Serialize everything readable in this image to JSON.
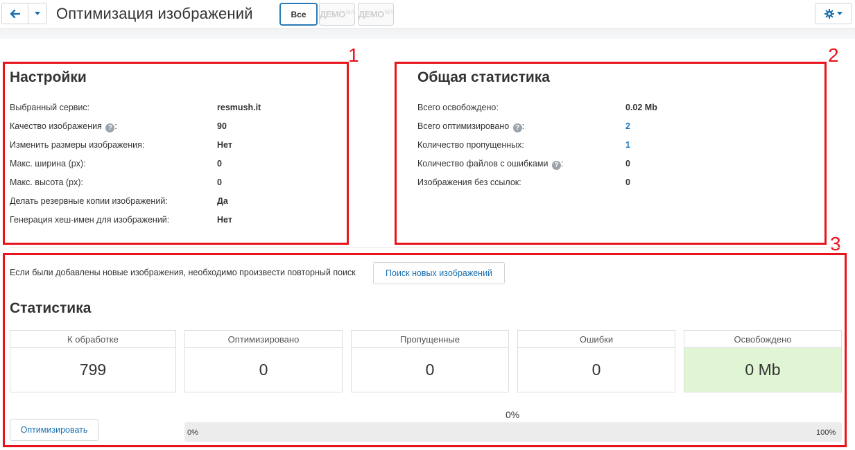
{
  "header": {
    "title": "Оптимизация изображений",
    "tabs": [
      {
        "label": "Все"
      },
      {
        "label": "ДЕМО",
        "suffix": "MA"
      },
      {
        "label": "ДЕМО",
        "suffix": "MA"
      }
    ],
    "back_icon": "arrow-left-icon",
    "caret_icon": "chevron-down-icon",
    "settings_icon": "gear-icon"
  },
  "annotations": [
    "1",
    "2",
    "3"
  ],
  "settings": {
    "title": "Настройки",
    "rows": [
      {
        "label": "Выбранный сервис:",
        "value": "resmush.it"
      },
      {
        "label": "Качество изображения",
        "value": "90",
        "help": "?"
      },
      {
        "label": "Изменить размеры изображения:",
        "value": "Нет"
      },
      {
        "label": "Макс. ширина (px):",
        "value": "0"
      },
      {
        "label": "Макс. высота (px):",
        "value": "0"
      },
      {
        "label": "Делать резервные копии изображений:",
        "value": "Да"
      },
      {
        "label": "Генерация хеш-имен для изображений:",
        "value": "Нет"
      }
    ]
  },
  "general_stats": {
    "title": "Общая статистика",
    "rows": [
      {
        "label": "Всего освобождено:",
        "value": "0.02 Mb"
      },
      {
        "label": "Всего оптимизировано",
        "value": "2",
        "help": "?"
      },
      {
        "label": "Количество пропущенных:",
        "value": "1"
      },
      {
        "label": "Количество файлов с ошибками",
        "value": "0",
        "help": "?"
      },
      {
        "label": "Изображения без ссылок:",
        "value": "0"
      }
    ]
  },
  "notice": {
    "text": "Если были добавлены новые изображения, необходимо произвести повторный поиск",
    "button": "Поиск новых изображений"
  },
  "statistics": {
    "title": "Статистика",
    "cards": [
      {
        "label": "К обработке",
        "value": "799"
      },
      {
        "label": "Оптимизировано",
        "value": "0"
      },
      {
        "label": "Пропущенные",
        "value": "0"
      },
      {
        "label": "Ошибки",
        "value": "0"
      },
      {
        "label": "Освобождено",
        "value": "0 Mb"
      }
    ]
  },
  "progress": {
    "percent_label": "0%",
    "value": 0,
    "min_label": "0%",
    "max_label": "100%"
  },
  "optimize_button": "Оптимизировать",
  "colors": {
    "accent": "#2a7ab8",
    "link": "#1a7ac0",
    "annotation": "#e8131b",
    "success_bg": "#dff5d3"
  }
}
